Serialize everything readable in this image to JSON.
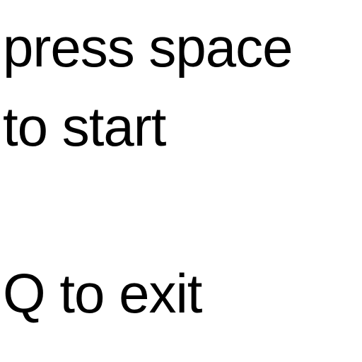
{
  "start_prompt": {
    "line1": "press space",
    "line2": "to start"
  },
  "exit_prompt": "Q to exit",
  "colors": {
    "background": "#ffffff",
    "text": "#000000"
  }
}
